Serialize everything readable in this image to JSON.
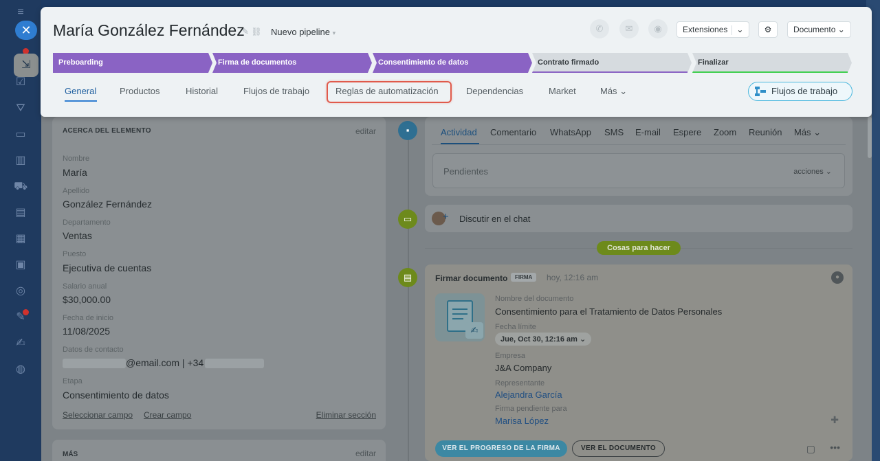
{
  "record": {
    "title": "María González Fernández",
    "pipeline": "Nuevo pipeline"
  },
  "header_actions": {
    "extensions": "Extensiones",
    "document": "Documento"
  },
  "stages": [
    {
      "label": "Preboarding",
      "state": "done"
    },
    {
      "label": "Firma de documentos",
      "state": "done"
    },
    {
      "label": "Consentimiento de datos",
      "state": "done"
    },
    {
      "label": "Contrato firmado",
      "state": "todo",
      "underline": "#8a63c4"
    },
    {
      "label": "Finalizar",
      "state": "todo",
      "underline": "#3fcf4f"
    }
  ],
  "tabs": {
    "general": "General",
    "productos": "Productos",
    "historial": "Historial",
    "flujos": "Flujos de trabajo",
    "reglas": "Reglas de automatización",
    "dependencias": "Dependencias",
    "market": "Market",
    "mas": "Más",
    "workflow_button": "Flujos de trabajo"
  },
  "about": {
    "header": "ACERCA DEL ELEMENTO",
    "edit": "editar",
    "fields": [
      {
        "label": "Nombre",
        "value": "María"
      },
      {
        "label": "Apellido",
        "value": "González Fernández"
      },
      {
        "label": "Departamento",
        "value": "Ventas"
      },
      {
        "label": "Puesto",
        "value": "Ejecutiva de cuentas"
      },
      {
        "label": "Salario anual",
        "value": "$30,000.00"
      },
      {
        "label": "Fecha de inicio",
        "value": "11/08/2025"
      },
      {
        "label": "Datos de contacto",
        "value": "@email.com | +34"
      },
      {
        "label": "Etapa",
        "value": "Consentimiento de datos"
      }
    ],
    "select_field": "Seleccionar campo",
    "create_field": "Crear campo",
    "delete_section": "Eliminar sección"
  },
  "more_section": {
    "header": "MÁS",
    "edit": "editar"
  },
  "activity": {
    "tabs": [
      "Actividad",
      "Comentario",
      "WhatsApp",
      "SMS",
      "E-mail",
      "Espere",
      "Zoom",
      "Reunión",
      "Más"
    ],
    "pending_placeholder": "Pendientes",
    "actions": "acciones"
  },
  "chat": {
    "label": "Discutir en el chat"
  },
  "todo_label": "Cosas para hacer",
  "document_task": {
    "title": "Firmar documento",
    "tag": "FIRMA",
    "time": "hoy, 12:16 am",
    "doc_name_label": "Nombre del documento",
    "doc_name": "Consentimiento para el Tratamiento de Datos Personales",
    "deadline_label": "Fecha límite",
    "deadline": "Jue, Oct 30, 12:16 am",
    "company_label": "Empresa",
    "company": "J&A Company",
    "representative_label": "Representante",
    "representative": "Alejandra García",
    "pending_label": "Firma pendiente para",
    "pending_for": "Marisa López",
    "btn_progress": "VER EL PROGRESO DE LA FIRMA",
    "btn_document": "VER EL DOCUMENTO"
  }
}
